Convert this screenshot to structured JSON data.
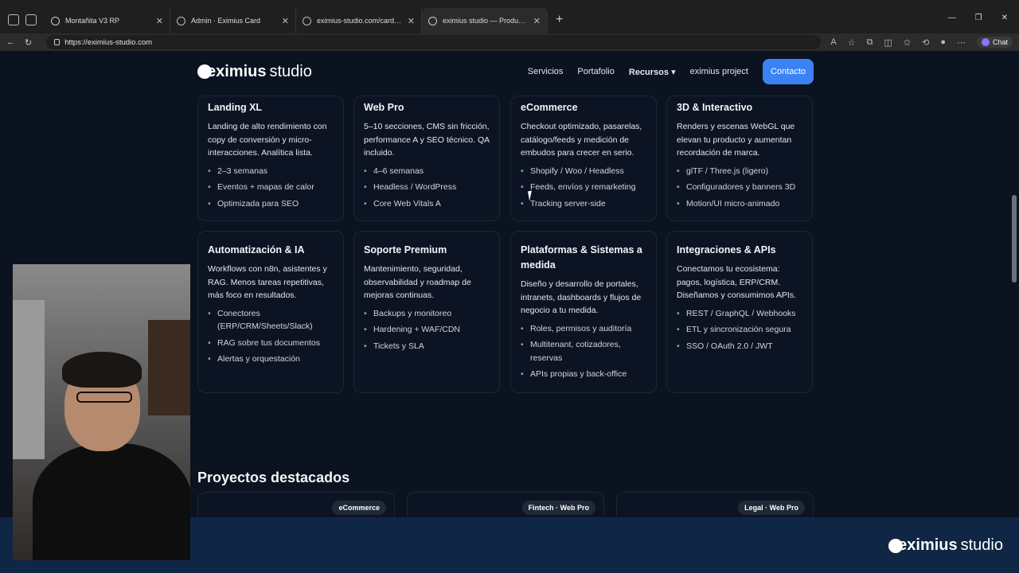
{
  "browser": {
    "tabs": [
      {
        "title": "Montañita V3 RP"
      },
      {
        "title": "Admin · Eximius Card"
      },
      {
        "title": "eximius-studio.com/card/app/re"
      },
      {
        "title": "eximius studio — Productos digi"
      }
    ],
    "url": "https://eximius-studio.com",
    "chat_label": "Chat"
  },
  "site": {
    "logo_brand": "eximius",
    "logo_word": "studio",
    "nav": [
      "Servicios",
      "Portafolio",
      "Recursos",
      "eximius project"
    ],
    "cta": "Contacto"
  },
  "services": [
    {
      "title": "Landing XL",
      "desc": "Landing de alto rendimiento con copy de conversión y micro-interacciones. Analítica lista.",
      "items": [
        "2–3 semanas",
        "Eventos + mapas de calor",
        "Optimizada para SEO"
      ]
    },
    {
      "title": "Web Pro",
      "desc": "5–10 secciones, CMS sin fricción, performance A y SEO técnico. QA incluido.",
      "items": [
        "4–6 semanas",
        "Headless / WordPress",
        "Core Web Vitals A"
      ]
    },
    {
      "title": "eCommerce",
      "desc": "Checkout optimizado, pasarelas, catálogo/feeds y medición de embudos para crecer en serio.",
      "items": [
        "Shopify / Woo / Headless",
        "Feeds, envíos y remarketing",
        "Tracking server-side"
      ]
    },
    {
      "title": "3D & Interactivo",
      "desc": "Renders y escenas WebGL que elevan tu producto y aumentan recordación de marca.",
      "items": [
        "glTF / Three.js (ligero)",
        "Configuradores y banners 3D",
        "Motion/UI micro-animado"
      ]
    },
    {
      "title": "Automatización & IA",
      "desc": "Workflows con n8n, asistentes y RAG. Menos tareas repetitivas, más foco en resultados.",
      "items": [
        "Conectores (ERP/CRM/Sheets/Slack)",
        "RAG sobre tus documentos",
        "Alertas y orquestación"
      ]
    },
    {
      "title": "Soporte Premium",
      "desc": "Mantenimiento, seguridad, observabilidad y roadmap de mejoras continuas.",
      "items": [
        "Backups y monitoreo",
        "Hardening + WAF/CDN",
        "Tickets y SLA"
      ]
    },
    {
      "title": "Plataformas & Sistemas a medida",
      "desc": "Diseño y desarrollo de portales, intranets, dashboards y flujos de negocio a tu medida.",
      "items": [
        "Roles, permisos y auditoría",
        "Multitenant, cotizadores, reservas",
        "APIs propias y back-office"
      ]
    },
    {
      "title": "Integraciones & APIs",
      "desc": "Conectamos tu ecosistema: pagos, logística, ERP/CRM. Diseñamos y consumimos APIs.",
      "items": [
        "REST / GraphQL / Webhooks",
        "ETL y sincronización segura",
        "SSO / OAuth 2.0 / JWT"
      ]
    }
  ],
  "projects": {
    "title": "Proyectos destacados",
    "badges": [
      "eCommerce",
      "Fintech · Web Pro",
      "Legal · Web Pro"
    ]
  }
}
